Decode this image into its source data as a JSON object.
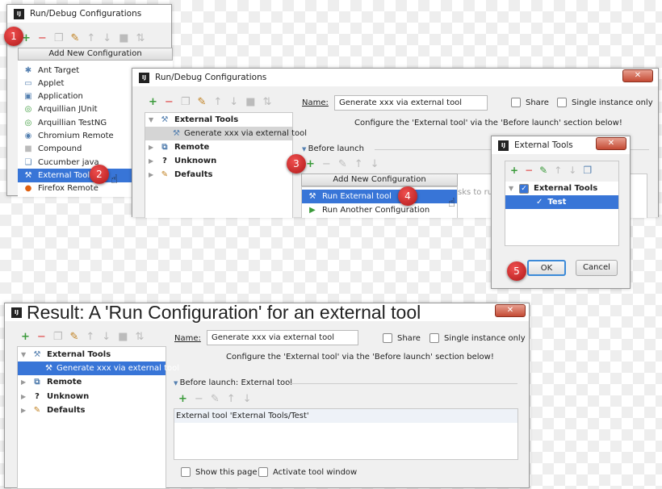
{
  "dialog_title": "Run/Debug Configurations",
  "popup_header": "Add New Configuration",
  "badges": [
    "1",
    "2",
    "3",
    "4",
    "5"
  ],
  "step1": {
    "config_types": [
      "Ant Target",
      "Applet",
      "Application",
      "Arquillian JUnit",
      "Arquillian TestNG",
      "Chromium Remote",
      "Compound",
      "Cucumber java",
      "External Tools",
      "Firefox Remote"
    ],
    "selected": "External Tools"
  },
  "tree": {
    "external_tools": "External Tools",
    "generate": "Generate xxx via external tool",
    "remote": "Remote",
    "unknown": "Unknown",
    "defaults": "Defaults"
  },
  "form": {
    "name_label": "Name:",
    "name_value": "Generate xxx via external tool",
    "share": "Share",
    "single_instance": "Single instance only",
    "hint": "Configure the 'External tool' via the 'Before launch' section below!",
    "before_launch": "Before launch",
    "before_launch_result": "Before launch: External tool"
  },
  "step3": {
    "items": [
      "Run External tool",
      "Run Another Configuration"
    ],
    "behind_text": "sks to run"
  },
  "ext_dialog": {
    "title": "External Tools",
    "group": "External Tools",
    "tool": "Test",
    "ok": "OK",
    "cancel": "Cancel"
  },
  "result": {
    "caption": "Result: A 'Run Configuration' for an external tool",
    "task": "External tool 'External Tools/Test'",
    "show_page": "Show this page",
    "activate": "Activate tool window"
  },
  "colors": {
    "selection": "#3875d7",
    "badge": "#d02828",
    "add": "#3a9a3a",
    "remove": "#d33333"
  }
}
